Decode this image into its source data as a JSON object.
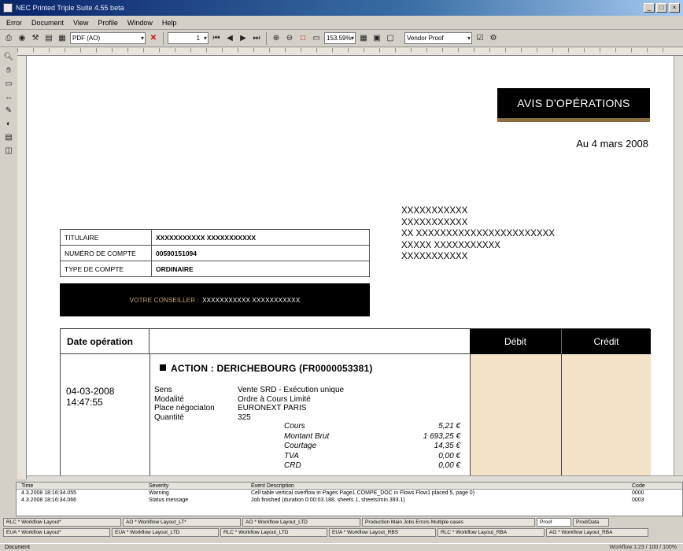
{
  "window": {
    "title": "NEC Printed Triple Suite 4.55 beta",
    "controls": [
      "_",
      "□",
      "×"
    ]
  },
  "menu": [
    "Error",
    "Document",
    "View",
    "Profile",
    "Window",
    "Help"
  ],
  "toolbar": {
    "format_combo": "PDF (AO)",
    "page_combo": "1",
    "zoom_combo": "153.59%",
    "proof_combo": "Vendor Proof"
  },
  "document": {
    "avis_title": "AVIS D'OPÉRATIONS",
    "date": "Au 4 mars 2008",
    "address_lines": [
      "XXXXXXXXXXX",
      "XXXXXXXXXXX",
      "XX XXXXXXXXXXXXXXXXXXXXXXX",
      "XXXXX XXXXXXXXXXX",
      "XXXXXXXXXXX"
    ],
    "info_table": [
      {
        "label": "TITULAIRE",
        "value": "XXXXXXXXXXX XXXXXXXXXXX"
      },
      {
        "label": "NUMÉRO DE COMPTE",
        "value": "00590151094"
      },
      {
        "label": "TYPE DE COMPTE",
        "value": "ORDINAIRE"
      }
    ],
    "conseiller_label": "VOTRE CONSEILLER :",
    "conseiller_value": "XXXXXXXXXXX XXXXXXXXXXX",
    "ops_header": {
      "date": "Date opération",
      "debit": "Débit",
      "credit": "Crédit"
    },
    "operation": {
      "title": "ACTION : DERICHEBOURG (FR0000053381)",
      "date": "04-03-2008",
      "time": "14:47:55",
      "fields": [
        {
          "k": "Sens",
          "v": "Vente SRD - Exécution unique"
        },
        {
          "k": "Modalité",
          "v": "Ordre à Cours Limité"
        },
        {
          "k": "Place négociaton",
          "v": "EURONEXT PARIS"
        },
        {
          "k": "Quantité",
          "v": "325"
        }
      ],
      "amounts": [
        {
          "k": "Cours",
          "v": "5,21 €"
        },
        {
          "k": "Montant Brut",
          "v": "1 693,25 €"
        },
        {
          "k": "Courtage",
          "v": "14,35 €"
        },
        {
          "k": "TVA",
          "v": "0,00 €"
        },
        {
          "k": "CRD",
          "v": "0,00 €"
        }
      ]
    }
  },
  "log": {
    "headers": [
      "Time",
      "Severity",
      "Event Description",
      "Code"
    ],
    "rows": [
      {
        "time": "4.3.2008 18:16:34.055",
        "severity": "Warning",
        "desc": "Cell table vertical overflow in Pages Page1.COMPE_DOC in Flows Flow1 placed 5, page 0)",
        "code": "0000"
      },
      {
        "time": "4.3.2008 18:16:34.066",
        "severity": "Status message",
        "desc": "Job finished (duration 0:00:03.188, sheets 1, sheets/min 393.1)",
        "code": "0003"
      }
    ]
  },
  "tabs_row1": [
    "RLC * Workflow Layout*",
    "AO * Workflow Layout_LT*",
    "AO * Workflow Layout_LTD",
    "Production  Main Jobs Errors Multiple cases",
    "Proof",
    "Prod/Data"
  ],
  "tabs_row2": [
    "EUA * Workflow Layout*",
    "EUA * Workflow Layout_LTD",
    "RLC * Workflow Layout_LTD",
    "EUA * Workflow Layout_RBS",
    "RLC * Workflow Layout_RBA",
    "AO * Workflow Layout_RBA"
  ],
  "status": {
    "left": "Document",
    "right": "Workflow  1:23 / 100 / 100%"
  }
}
